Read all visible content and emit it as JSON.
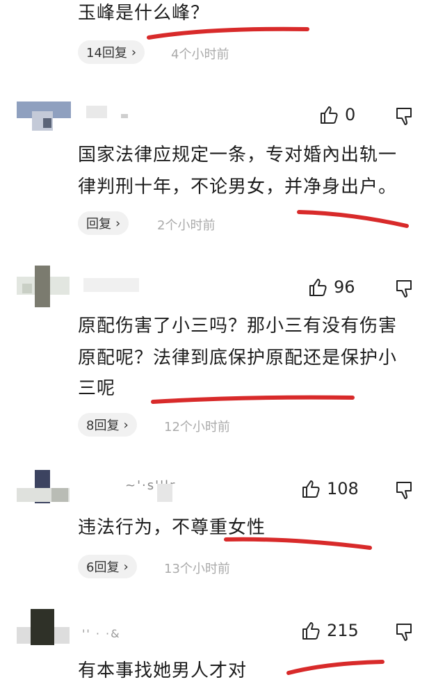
{
  "top_comment": {
    "text": "玉峰是什么峰？",
    "reply_label": "14回复",
    "time": "4个小时前"
  },
  "comments": [
    {
      "likes": "0",
      "text_line1": "国家法律应规定一条，专对婚內出轨一",
      "text_line2": "律判刑十年，不论男女，并净身出户。",
      "reply_label": "回复",
      "time": "2个小时前"
    },
    {
      "likes": "96",
      "text_line1": "原配伤害了小三吗？那小三有没有伤害",
      "text_line2": "原配呢？法律到底保护原配还是保护小",
      "text_line3": "三呢",
      "reply_label": "8回复",
      "time": "12个小时前"
    },
    {
      "likes": "108",
      "username": "~'·s''lr",
      "text_line1": "违法行为，不尊重女性",
      "reply_label": "6回复",
      "time": "13个小时前"
    },
    {
      "likes": "215",
      "username": "'' ·  ·&",
      "text_line1": "有本事找她男人才对"
    }
  ],
  "colors": {
    "underline": "#d82a2a",
    "pill_bg": "#f1f1f1",
    "time": "#aaaaaa"
  },
  "icons": {
    "like": "thumbs-up-icon",
    "dislike": "thumbs-down-icon",
    "chevron": "chevron-right-icon"
  }
}
